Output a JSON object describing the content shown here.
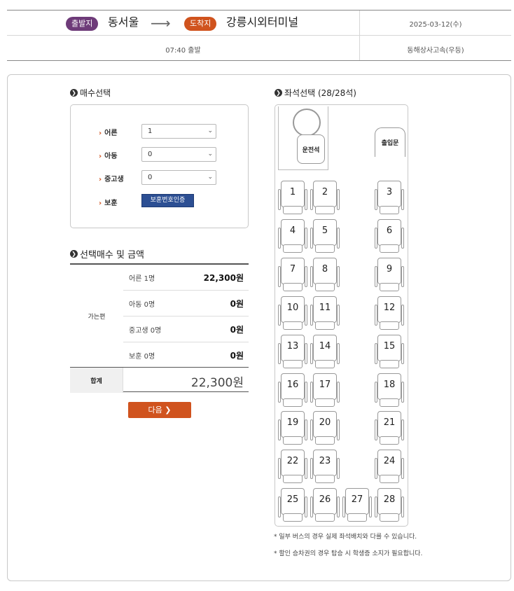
{
  "route": {
    "dep_badge": "출발지",
    "dep_place": "동서울",
    "arr_badge": "도착지",
    "arr_place": "강릉시외터미널",
    "date": "2025-03-12(수)",
    "dep_time": "07:40 출발",
    "carrier": "동해상사고속(우등)"
  },
  "count_section": {
    "title": "매수선택",
    "rows": [
      {
        "label": "어른",
        "value": "1"
      },
      {
        "label": "아동",
        "value": "0"
      },
      {
        "label": "중고생",
        "value": "0"
      }
    ],
    "guardian_label": "보훈",
    "guardian_button": "보훈번호인증"
  },
  "price_section": {
    "title": "선택매수 및 금액",
    "group_label": "가는편",
    "rows": [
      {
        "label": "어른 1명",
        "value": "22,300원"
      },
      {
        "label": "아동 0명",
        "value": "0원"
      },
      {
        "label": "중고생 0명",
        "value": "0원"
      },
      {
        "label": "보훈 0명",
        "value": "0원"
      }
    ],
    "total_label": "합계",
    "total_value": "22,300원"
  },
  "next_button": "다음",
  "seat_section": {
    "title": "좌석선택 (28/28석)",
    "driver_label": "운전석",
    "door_label": "출입문",
    "seats": [
      "1",
      "2",
      "3",
      "4",
      "5",
      "6",
      "7",
      "8",
      "9",
      "10",
      "11",
      "12",
      "13",
      "14",
      "15",
      "16",
      "17",
      "18",
      "19",
      "20",
      "21",
      "22",
      "23",
      "24",
      "25",
      "26",
      "27",
      "28"
    ]
  },
  "notes": [
    "* 일부 버스의 경우 실제 좌석배치와 다를 수 있습니다.",
    "* 할인 승차권의 경우 탑승 시 학생증 소지가 필요합니다."
  ]
}
